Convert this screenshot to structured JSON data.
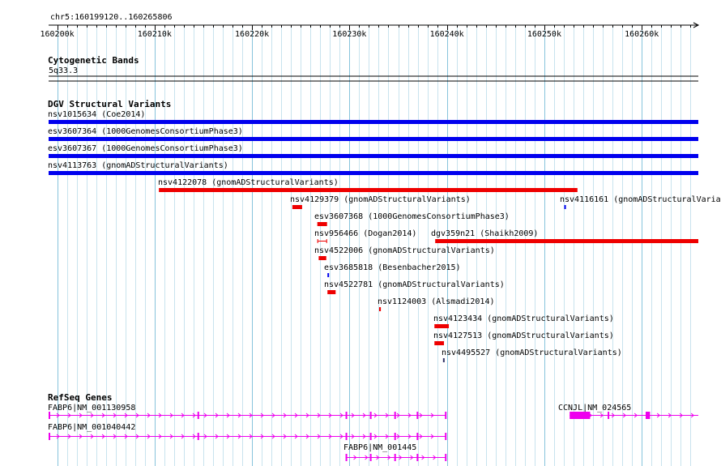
{
  "ruler": {
    "title": "chr5:160199120..160265806",
    "start": 160199120,
    "end": 160265806,
    "ticks": [
      {
        "pos": 160200000,
        "label": "160200k"
      },
      {
        "pos": 160210000,
        "label": "160210k"
      },
      {
        "pos": 160220000,
        "label": "160220k"
      },
      {
        "pos": 160230000,
        "label": "160230k"
      },
      {
        "pos": 160240000,
        "label": "160240k"
      },
      {
        "pos": 160250000,
        "label": "160250k"
      },
      {
        "pos": 160260000,
        "label": "160260k"
      }
    ]
  },
  "cytobands": {
    "title": "Cytogenetic Bands",
    "band": "5q33.3"
  },
  "dgv": {
    "title": "DGV Structural Variants",
    "colors": {
      "blue": "#0000ee",
      "red": "#ee0000"
    },
    "features": [
      {
        "label": "nsv1015634 (Coe2014)",
        "color": "blue",
        "start": 160199120,
        "end": 160265806
      },
      {
        "label": "esv3607364 (1000GenomesConsortiumPhase3)",
        "color": "blue",
        "start": 160199120,
        "end": 160265806
      },
      {
        "label": "esv3607367 (1000GenomesConsortiumPhase3)",
        "color": "blue",
        "start": 160199120,
        "end": 160265806
      },
      {
        "label": "nsv4113763 (gnomADStructuralVariants)",
        "color": "blue",
        "start": 160199120,
        "end": 160265806
      },
      {
        "label": "nsv4122078 (gnomADStructuralVariants)",
        "color": "red",
        "start": 160210440,
        "end": 160253400
      },
      {
        "label": "nsv4129379 (gnomADStructuralVariants)",
        "color": "red",
        "start": 160224140,
        "end": 160225140
      },
      {
        "label": "nsv4116161 (gnomADStructuralVaria",
        "color": "blue",
        "start": 160252050,
        "end": 160252200
      },
      {
        "label": "esv3607368 (1000GenomesConsortiumPhase3)",
        "color": "red",
        "start": 160226700,
        "end": 160227700
      },
      {
        "label": "nsv956466 (Dogan2014)",
        "color": "red",
        "start": 160226700,
        "end": 160227700,
        "style": "range"
      },
      {
        "label": "dgv359n21 (Shaikh2009)",
        "color": "red",
        "start": 160238800,
        "end": 160265806
      },
      {
        "label": "nsv4522006 (gnomADStructuralVariants)",
        "color": "red",
        "start": 160226840,
        "end": 160227620
      },
      {
        "label": "esv3685818 (Besenbacher2015)",
        "color": "blue",
        "start": 160227740,
        "end": 160227900
      },
      {
        "label": "nsv4522781 (gnomADStructuralVariants)",
        "color": "red",
        "start": 160227740,
        "end": 160228580
      },
      {
        "label": "nsv1124003 (Alsmadi2014)",
        "color": "red",
        "start": 160233040,
        "end": 160233220
      },
      {
        "label": "nsv4123434 (gnomADStructuralVariants)",
        "color": "red",
        "start": 160238720,
        "end": 160240200
      },
      {
        "label": "nsv4127513 (gnomADStructuralVariants)",
        "color": "red",
        "start": 160238720,
        "end": 160239700
      },
      {
        "label": "nsv4495527 (gnomADStructuralVariants)",
        "color": "dark",
        "start": 160239600,
        "end": 160239760
      }
    ]
  },
  "refseq": {
    "title": "RefSeq Genes",
    "color": "#ee00ee",
    "genes": [
      {
        "label": "FABP6|NM_001130958",
        "start": 160199120,
        "end": 160239940,
        "exons": [
          [
            160199120,
            160199200
          ],
          [
            160214400,
            160214500
          ],
          [
            160229600,
            160229700
          ],
          [
            160232100,
            160232200
          ],
          [
            160234600,
            160234700
          ],
          [
            160236900,
            160237000
          ],
          [
            160239800,
            160239900
          ]
        ]
      },
      {
        "label": "FABP6|NM_001040442",
        "start": 160199120,
        "end": 160239940,
        "exons": [
          [
            160199120,
            160199200
          ],
          [
            160214400,
            160214500
          ],
          [
            160229600,
            160229700
          ],
          [
            160232100,
            160232200
          ],
          [
            160234600,
            160234700
          ],
          [
            160236900,
            160237000
          ],
          [
            160239800,
            160239900
          ]
        ]
      },
      {
        "label": "FABP6|NM_001445",
        "start": 160229600,
        "end": 160239940,
        "exons": [
          [
            160229600,
            160229700
          ],
          [
            160232100,
            160232200
          ],
          [
            160234600,
            160234700
          ],
          [
            160236900,
            160237000
          ],
          [
            160239800,
            160239900
          ]
        ]
      },
      {
        "label": "CCNJL|NM_024565",
        "start": 160252600,
        "end": 160265806,
        "exons": [
          [
            160252600,
            160254700
          ],
          [
            160256500,
            160256650
          ],
          [
            160260400,
            160260850
          ]
        ]
      }
    ]
  }
}
